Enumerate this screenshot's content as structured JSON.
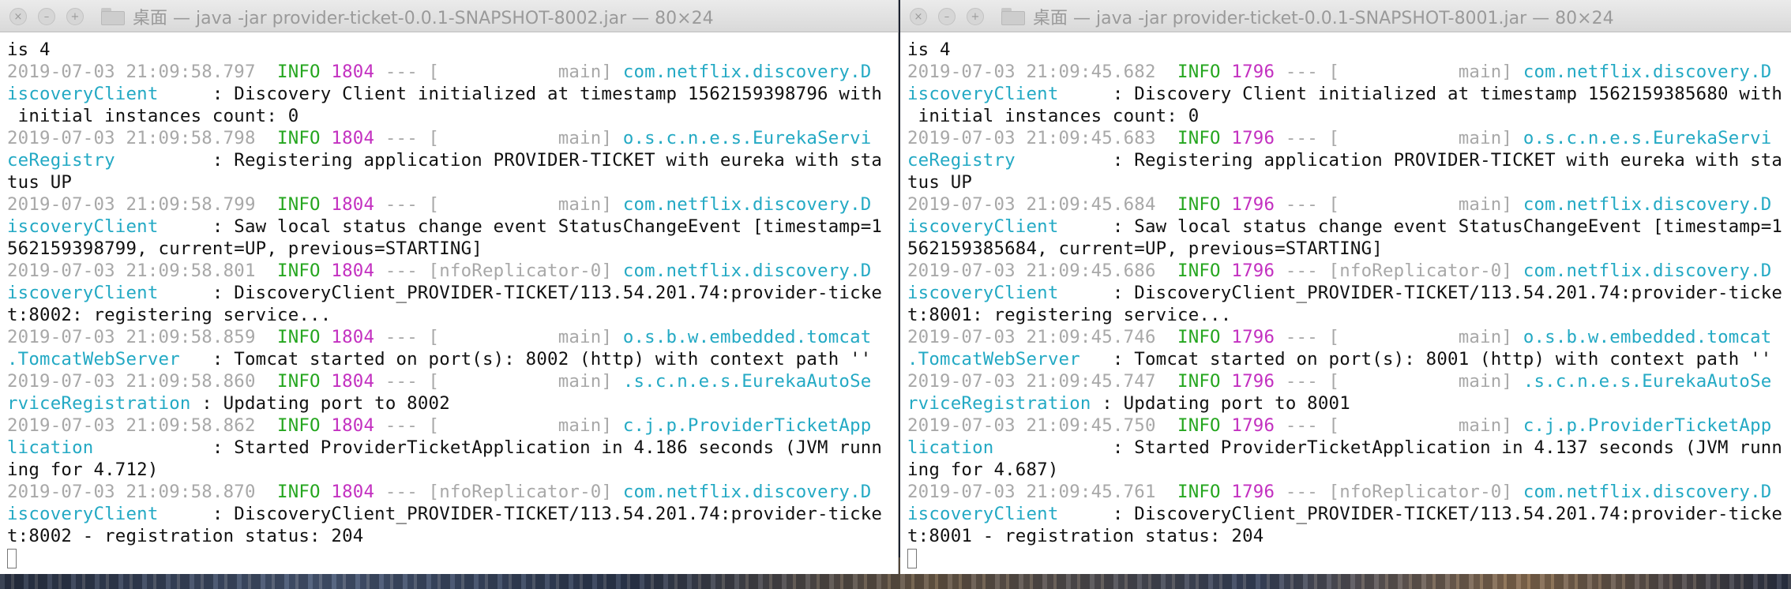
{
  "left_window": {
    "title": "桌面 — java -jar provider-ticket-0.0.1-SNAPSHOT-8002.jar — 80×24",
    "traffic_lights": [
      "close-icon",
      "minimize-icon",
      "zoom-icon"
    ],
    "lines": [
      {
        "text": "is 4"
      },
      {
        "ts": "2019-07-03 21:09:58.797",
        "lvl": "INFO",
        "pid": "1804",
        "sep": " --- [",
        "thr": "           main]",
        "logger": " com.netflix.discovery.D"
      },
      {
        "cls": "iscoveryClient",
        "msg": "     : Discovery Client initialized at timestamp 1562159398796 with"
      },
      {
        "text": " initial instances count: 0"
      },
      {
        "ts": "2019-07-03 21:09:58.798",
        "lvl": "INFO",
        "pid": "1804",
        "sep": " --- [",
        "thr": "           main]",
        "logger": " o.s.c.n.e.s.EurekaServi"
      },
      {
        "cls": "ceRegistry",
        "msg": "         : Registering application PROVIDER-TICKET with eureka with sta"
      },
      {
        "text": "tus UP"
      },
      {
        "ts": "2019-07-03 21:09:58.799",
        "lvl": "INFO",
        "pid": "1804",
        "sep": " --- [",
        "thr": "           main]",
        "logger": " com.netflix.discovery.D"
      },
      {
        "cls": "iscoveryClient",
        "msg": "     : Saw local status change event StatusChangeEvent [timestamp=1"
      },
      {
        "text": "562159398799, current=UP, previous=STARTING]"
      },
      {
        "ts": "2019-07-03 21:09:58.801",
        "lvl": "INFO",
        "pid": "1804",
        "sep": " --- [",
        "thr": "nfoReplicator-0]",
        "logger": " com.netflix.discovery.D"
      },
      {
        "cls": "iscoveryClient",
        "msg": "     : DiscoveryClient_PROVIDER-TICKET/113.54.201.74:provider-ticke"
      },
      {
        "text": "t:8002: registering service..."
      },
      {
        "ts": "2019-07-03 21:09:58.859",
        "lvl": "INFO",
        "pid": "1804",
        "sep": " --- [",
        "thr": "           main]",
        "logger": " o.s.b.w.embedded.tomcat"
      },
      {
        "cls": ".TomcatWebServer",
        "msg": "   : Tomcat started on port(s): 8002 (http) with context path ''"
      },
      {
        "ts": "2019-07-03 21:09:58.860",
        "lvl": "INFO",
        "pid": "1804",
        "sep": " --- [",
        "thr": "           main]",
        "logger": " .s.c.n.e.s.EurekaAutoSe"
      },
      {
        "cls": "rviceRegistration",
        "msg": " : Updating port to 8002"
      },
      {
        "ts": "2019-07-03 21:09:58.862",
        "lvl": "INFO",
        "pid": "1804",
        "sep": " --- [",
        "thr": "           main]",
        "logger": " c.j.p.ProviderTicketApp"
      },
      {
        "cls": "lication",
        "msg": "           : Started ProviderTicketApplication in 4.186 seconds (JVM runn"
      },
      {
        "text": "ing for 4.712)"
      },
      {
        "ts": "2019-07-03 21:09:58.870",
        "lvl": "INFO",
        "pid": "1804",
        "sep": " --- [",
        "thr": "nfoReplicator-0]",
        "logger": " com.netflix.discovery.D"
      },
      {
        "cls": "iscoveryClient",
        "msg": "     : DiscoveryClient_PROVIDER-TICKET/113.54.201.74:provider-ticke"
      },
      {
        "text": "t:8002 - registration status: 204"
      },
      {
        "cursor": true
      }
    ]
  },
  "right_window": {
    "title": "桌面 — java -jar provider-ticket-0.0.1-SNAPSHOT-8001.jar — 80×24",
    "traffic_lights": [
      "close-icon",
      "minimize-icon",
      "zoom-icon"
    ],
    "lines": [
      {
        "text": "is 4"
      },
      {
        "ts": "2019-07-03 21:09:45.682",
        "lvl": "INFO",
        "pid": "1796",
        "sep": " --- [",
        "thr": "           main]",
        "logger": " com.netflix.discovery.D"
      },
      {
        "cls": "iscoveryClient",
        "msg": "     : Discovery Client initialized at timestamp 1562159385680 with"
      },
      {
        "text": " initial instances count: 0"
      },
      {
        "ts": "2019-07-03 21:09:45.683",
        "lvl": "INFO",
        "pid": "1796",
        "sep": " --- [",
        "thr": "           main]",
        "logger": " o.s.c.n.e.s.EurekaServi"
      },
      {
        "cls": "ceRegistry",
        "msg": "         : Registering application PROVIDER-TICKET with eureka with sta"
      },
      {
        "text": "tus UP"
      },
      {
        "ts": "2019-07-03 21:09:45.684",
        "lvl": "INFO",
        "pid": "1796",
        "sep": " --- [",
        "thr": "           main]",
        "logger": " com.netflix.discovery.D"
      },
      {
        "cls": "iscoveryClient",
        "msg": "     : Saw local status change event StatusChangeEvent [timestamp=1"
      },
      {
        "text": "562159385684, current=UP, previous=STARTING]"
      },
      {
        "ts": "2019-07-03 21:09:45.686",
        "lvl": "INFO",
        "pid": "1796",
        "sep": " --- [",
        "thr": "nfoReplicator-0]",
        "logger": " com.netflix.discovery.D"
      },
      {
        "cls": "iscoveryClient",
        "msg": "     : DiscoveryClient_PROVIDER-TICKET/113.54.201.74:provider-ticke"
      },
      {
        "text": "t:8001: registering service..."
      },
      {
        "ts": "2019-07-03 21:09:45.746",
        "lvl": "INFO",
        "pid": "1796",
        "sep": " --- [",
        "thr": "           main]",
        "logger": " o.s.b.w.embedded.tomcat"
      },
      {
        "cls": ".TomcatWebServer",
        "msg": "   : Tomcat started on port(s): 8001 (http) with context path ''"
      },
      {
        "ts": "2019-07-03 21:09:45.747",
        "lvl": "INFO",
        "pid": "1796",
        "sep": " --- [",
        "thr": "           main]",
        "logger": " .s.c.n.e.s.EurekaAutoSe"
      },
      {
        "cls": "rviceRegistration",
        "msg": " : Updating port to 8001"
      },
      {
        "ts": "2019-07-03 21:09:45.750",
        "lvl": "INFO",
        "pid": "1796",
        "sep": " --- [",
        "thr": "           main]",
        "logger": " c.j.p.ProviderTicketApp"
      },
      {
        "cls": "lication",
        "msg": "           : Started ProviderTicketApplication in 4.137 seconds (JVM runn"
      },
      {
        "text": "ing for 4.687)"
      },
      {
        "ts": "2019-07-03 21:09:45.761",
        "lvl": "INFO",
        "pid": "1796",
        "sep": " --- [",
        "thr": "nfoReplicator-0]",
        "logger": " com.netflix.discovery.D"
      },
      {
        "cls": "iscoveryClient",
        "msg": "     : DiscoveryClient_PROVIDER-TICKET/113.54.201.74:provider-ticke"
      },
      {
        "text": "t:8001 - registration status: 204"
      },
      {
        "cursor": true
      }
    ]
  }
}
